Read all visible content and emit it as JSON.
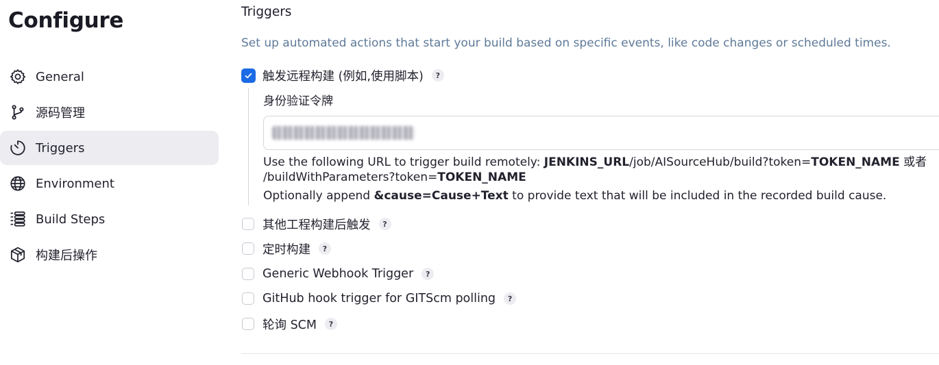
{
  "page": {
    "title": "Configure"
  },
  "sidebar": {
    "items": [
      {
        "label": "General",
        "icon": "gear-icon",
        "active": false
      },
      {
        "label": "源码管理",
        "icon": "source-branch-icon",
        "active": false
      },
      {
        "label": "Triggers",
        "icon": "timer-icon",
        "active": true
      },
      {
        "label": "Environment",
        "icon": "globe-icon",
        "active": false
      },
      {
        "label": "Build Steps",
        "icon": "list-icon",
        "active": false
      },
      {
        "label": "构建后操作",
        "icon": "package-icon",
        "active": false
      }
    ]
  },
  "triggers": {
    "title": "Triggers",
    "description": "Set up automated actions that start your build based on specific events, like code changes or scheduled times.",
    "remote": {
      "label": "触发远程构建 (例如,使用脚本)",
      "checked": true,
      "token_label": "身份验证令牌",
      "token_value": "",
      "help_line1_prefix": "Use the following URL to trigger build remotely: ",
      "help_line1_url_var": "JENKINS_URL",
      "help_line1_path": "/job/AISourceHub/build?token=",
      "help_line1_token": "TOKEN_NAME",
      "help_line1_suffix": " 或者",
      "help_line2_path": "/buildWithParameters?token=",
      "help_line2_token": "TOKEN_NAME",
      "help_line3_prefix": "Optionally append ",
      "help_line3_param": "&cause=Cause+Text",
      "help_line3_suffix": " to provide text that will be included in the recorded build cause."
    },
    "options": [
      {
        "label": "其他工程构建后触发",
        "checked": false
      },
      {
        "label": "定时构建",
        "checked": false
      },
      {
        "label": "Generic Webhook Trigger",
        "checked": false
      },
      {
        "label": "GitHub hook trigger for GITScm polling",
        "checked": false
      },
      {
        "label": "轮询 SCM",
        "checked": false
      }
    ],
    "help_glyph": "?"
  },
  "colors": {
    "accent": "#1b6ae6",
    "description": "#5e7a98",
    "active_bg": "#ececf1"
  }
}
